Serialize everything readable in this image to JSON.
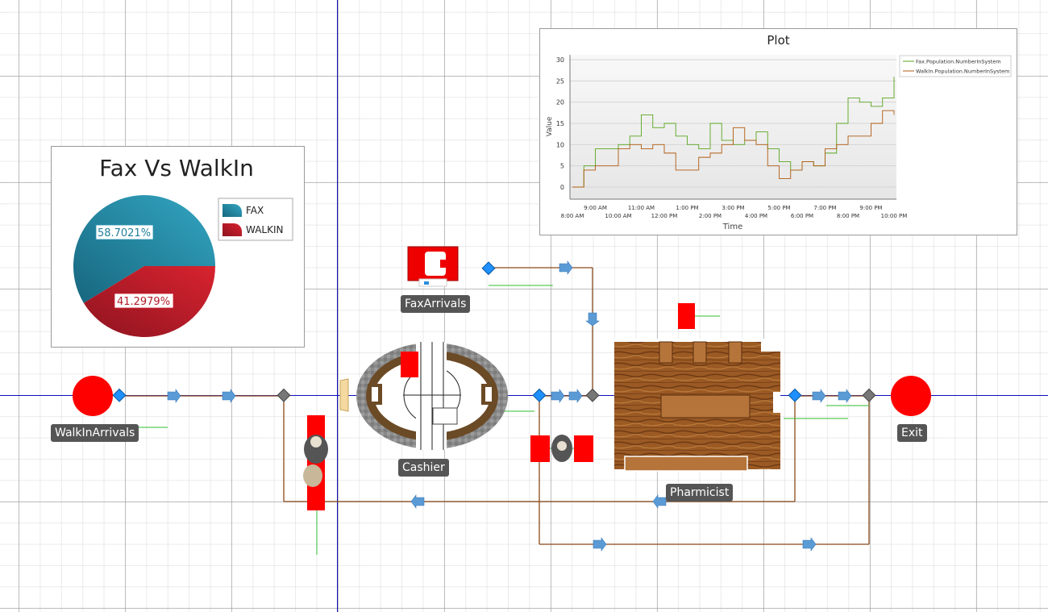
{
  "pie": {
    "title": "Fax Vs WalkIn",
    "legend": [
      "FAX",
      "WALKIN"
    ],
    "slice_labels": [
      "58.7021%",
      "41.2979%"
    ],
    "colors": [
      "#2a95b2",
      "#c8202f"
    ]
  },
  "plot": {
    "title": "Plot",
    "xlabel": "Time",
    "ylabel": "Value"
  },
  "objects": {
    "walkin": "WalkInArrivals",
    "fax": "FaxArrivals",
    "cashier": "Cashier",
    "pharmicist": "Pharmicist",
    "exit": "Exit"
  },
  "chart_data": [
    {
      "type": "pie",
      "title": "Fax Vs WalkIn",
      "categories": [
        "FAX",
        "WALKIN"
      ],
      "values": [
        58.7021,
        41.2979
      ],
      "colors": [
        "#2a95b2",
        "#c8202f"
      ],
      "legend": "right"
    },
    {
      "type": "line",
      "title": "Plot",
      "xlabel": "Time",
      "ylabel": "Value",
      "ylim": [
        0,
        30
      ],
      "yticks": [
        "0",
        "5",
        "10",
        "15",
        "20",
        "25",
        "30"
      ],
      "xlim": [
        "8:00 AM",
        "10:00 PM"
      ],
      "xticks_top": [
        "9:00 AM",
        "11:00 AM",
        "1:00 PM",
        "3:00 PM",
        "5:00 PM",
        "7:00 PM",
        "9:00 PM"
      ],
      "xticks_bottom": [
        "8:00 AM",
        "10:00 AM",
        "12:00 PM",
        "2:00 PM",
        "4:00 PM",
        "6:00 PM",
        "8:00 PM",
        "10:00 PM"
      ],
      "grid": true,
      "legend": "top-right",
      "x_hours": [
        8,
        8.5,
        9,
        9.5,
        10,
        10.5,
        11,
        11.5,
        12,
        12.5,
        13,
        13.5,
        14,
        14.5,
        15,
        15.5,
        16,
        16.5,
        17,
        17.5,
        18,
        18.5,
        19,
        19.5,
        20,
        20.5,
        21,
        21.5,
        22
      ],
      "series": [
        {
          "name": "Fax.Population.NumberInSystem",
          "color": "#5aa51e",
          "values": [
            0,
            5,
            9,
            9,
            10,
            12,
            17,
            14,
            15,
            12,
            10,
            9,
            15,
            11,
            10,
            11,
            13,
            9,
            6,
            4,
            6,
            5,
            8,
            15,
            21,
            20,
            19,
            21,
            26
          ]
        },
        {
          "name": "WalkIn.Population.NumberInSystem",
          "color": "#b05a10",
          "values": [
            0,
            4,
            5,
            5,
            9,
            10,
            9,
            10,
            8,
            4,
            4,
            7,
            8,
            10,
            14,
            11,
            10,
            5,
            2,
            4,
            6,
            5,
            9,
            10,
            12,
            12,
            15,
            18,
            17
          ]
        }
      ]
    }
  ]
}
